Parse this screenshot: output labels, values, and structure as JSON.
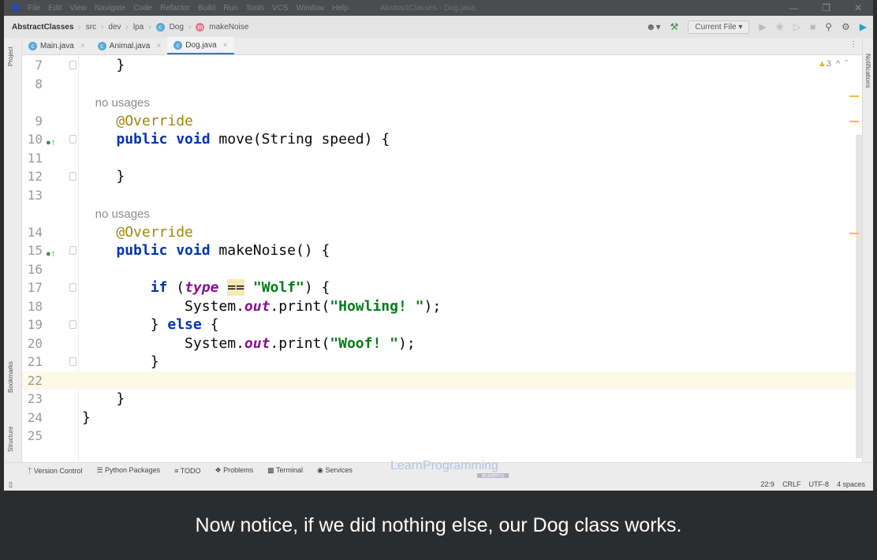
{
  "titlebar": {
    "menu": [
      "File",
      "Edit",
      "View",
      "Navigate",
      "Code",
      "Refactor",
      "Build",
      "Run",
      "Tools",
      "VCS",
      "Window",
      "Help"
    ],
    "title": "AbstractClasses - Dog.java"
  },
  "breadcrumb": {
    "project": "AbstractClasses",
    "items": [
      "src",
      "dev",
      "lpa"
    ],
    "class": "Dog",
    "method": "makeNoise"
  },
  "toolbar": {
    "run_config": "Current File"
  },
  "tabs": [
    {
      "label": "Main.java"
    },
    {
      "label": "Animal.java"
    },
    {
      "label": "Dog.java",
      "active": true
    }
  ],
  "side": {
    "project": "Project",
    "bookmarks": "Bookmarks",
    "structure": "Structure",
    "notifications": "Notifications"
  },
  "editor": {
    "warnings": "3",
    "current_line": 22,
    "lines": [
      {
        "n": "7",
        "t": [
          [
            "p",
            "    }"
          ]
        ]
      },
      {
        "n": "8",
        "t": []
      },
      {
        "n": "",
        "hint": "    no usages"
      },
      {
        "n": "9",
        "t": [
          [
            "p",
            "    "
          ],
          [
            "ann",
            "@Override"
          ]
        ]
      },
      {
        "n": "10",
        "ovr": true,
        "t": [
          [
            "p",
            "    "
          ],
          [
            "kw",
            "public void"
          ],
          [
            "p",
            " move(String speed) {"
          ]
        ]
      },
      {
        "n": "11",
        "t": []
      },
      {
        "n": "12",
        "t": [
          [
            "p",
            "    }"
          ]
        ]
      },
      {
        "n": "13",
        "t": []
      },
      {
        "n": "",
        "hint": "    no usages"
      },
      {
        "n": "14",
        "t": [
          [
            "p",
            "    "
          ],
          [
            "ann",
            "@Override"
          ]
        ]
      },
      {
        "n": "15",
        "ovr": true,
        "t": [
          [
            "p",
            "    "
          ],
          [
            "kw",
            "public void"
          ],
          [
            "p",
            " makeNoise() {"
          ]
        ]
      },
      {
        "n": "16",
        "t": []
      },
      {
        "n": "17",
        "t": [
          [
            "p",
            "        "
          ],
          [
            "kw",
            "if"
          ],
          [
            "p",
            " ("
          ],
          [
            "fld2",
            "type"
          ],
          [
            "p",
            " "
          ],
          [
            "hl",
            "=="
          ],
          [
            "p",
            " "
          ],
          [
            "str",
            "\"Wolf\""
          ],
          [
            "p",
            ") {"
          ]
        ]
      },
      {
        "n": "18",
        "t": [
          [
            "p",
            "            System."
          ],
          [
            "fld",
            "out"
          ],
          [
            "p",
            ".print("
          ],
          [
            "str",
            "\"Howling! \""
          ],
          [
            "p",
            ");"
          ]
        ]
      },
      {
        "n": "19",
        "t": [
          [
            "p",
            "        } "
          ],
          [
            "kw",
            "else"
          ],
          [
            "p",
            " {"
          ]
        ]
      },
      {
        "n": "20",
        "t": [
          [
            "p",
            "            System."
          ],
          [
            "fld",
            "out"
          ],
          [
            "p",
            ".print("
          ],
          [
            "str",
            "\"Woof! \""
          ],
          [
            "p",
            ");"
          ]
        ]
      },
      {
        "n": "21",
        "t": [
          [
            "p",
            "        }"
          ]
        ]
      },
      {
        "n": "22",
        "t": []
      },
      {
        "n": "23",
        "t": [
          [
            "p",
            "    }"
          ]
        ]
      },
      {
        "n": "24",
        "t": [
          [
            "p",
            "}"
          ]
        ]
      },
      {
        "n": "25",
        "t": []
      }
    ]
  },
  "toolwindows": [
    "Version Control",
    "Python Packages",
    "TODO",
    "Problems",
    "Terminal",
    "Services"
  ],
  "status": {
    "position": "22:9",
    "line_sep": "CRLF",
    "encoding": "UTF-8",
    "indent": "4 spaces"
  },
  "watermark": {
    "brand": "LearnProgramming",
    "sub": "academy"
  },
  "caption": "Now notice, if we did nothing else, our Dog class works."
}
